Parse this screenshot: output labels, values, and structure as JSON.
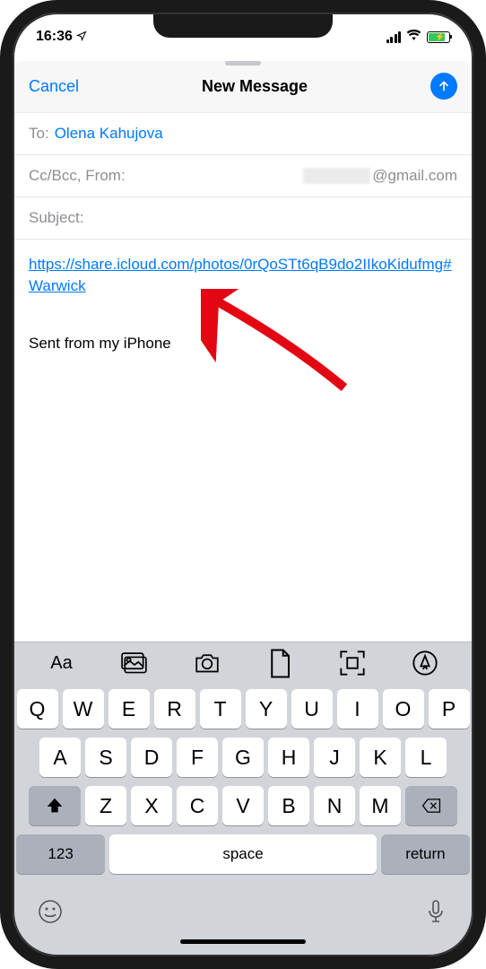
{
  "status_bar": {
    "time": "16:36",
    "location_indicator": "➤",
    "battery_charging": true
  },
  "header": {
    "cancel_label": "Cancel",
    "title": "New Message"
  },
  "compose": {
    "to_label": "To:",
    "to_value": "Olena Kahujova",
    "ccbcc_from_label": "Cc/Bcc, From:",
    "from_suffix": "@gmail.com",
    "subject_label": "Subject:",
    "subject_value": "",
    "body_link": "https://share.icloud.com/photos/0rQoSTt6qB9do2IIkoKidufmg#Warwick",
    "signature": "Sent from my iPhone"
  },
  "keyboard": {
    "row1": [
      "Q",
      "W",
      "E",
      "R",
      "T",
      "Y",
      "U",
      "I",
      "O",
      "P"
    ],
    "row2": [
      "A",
      "S",
      "D",
      "F",
      "G",
      "H",
      "J",
      "K",
      "L"
    ],
    "row3": [
      "Z",
      "X",
      "C",
      "V",
      "B",
      "N",
      "M"
    ],
    "numbers_label": "123",
    "space_label": "space",
    "return_label": "return",
    "format_label": "Aa"
  }
}
